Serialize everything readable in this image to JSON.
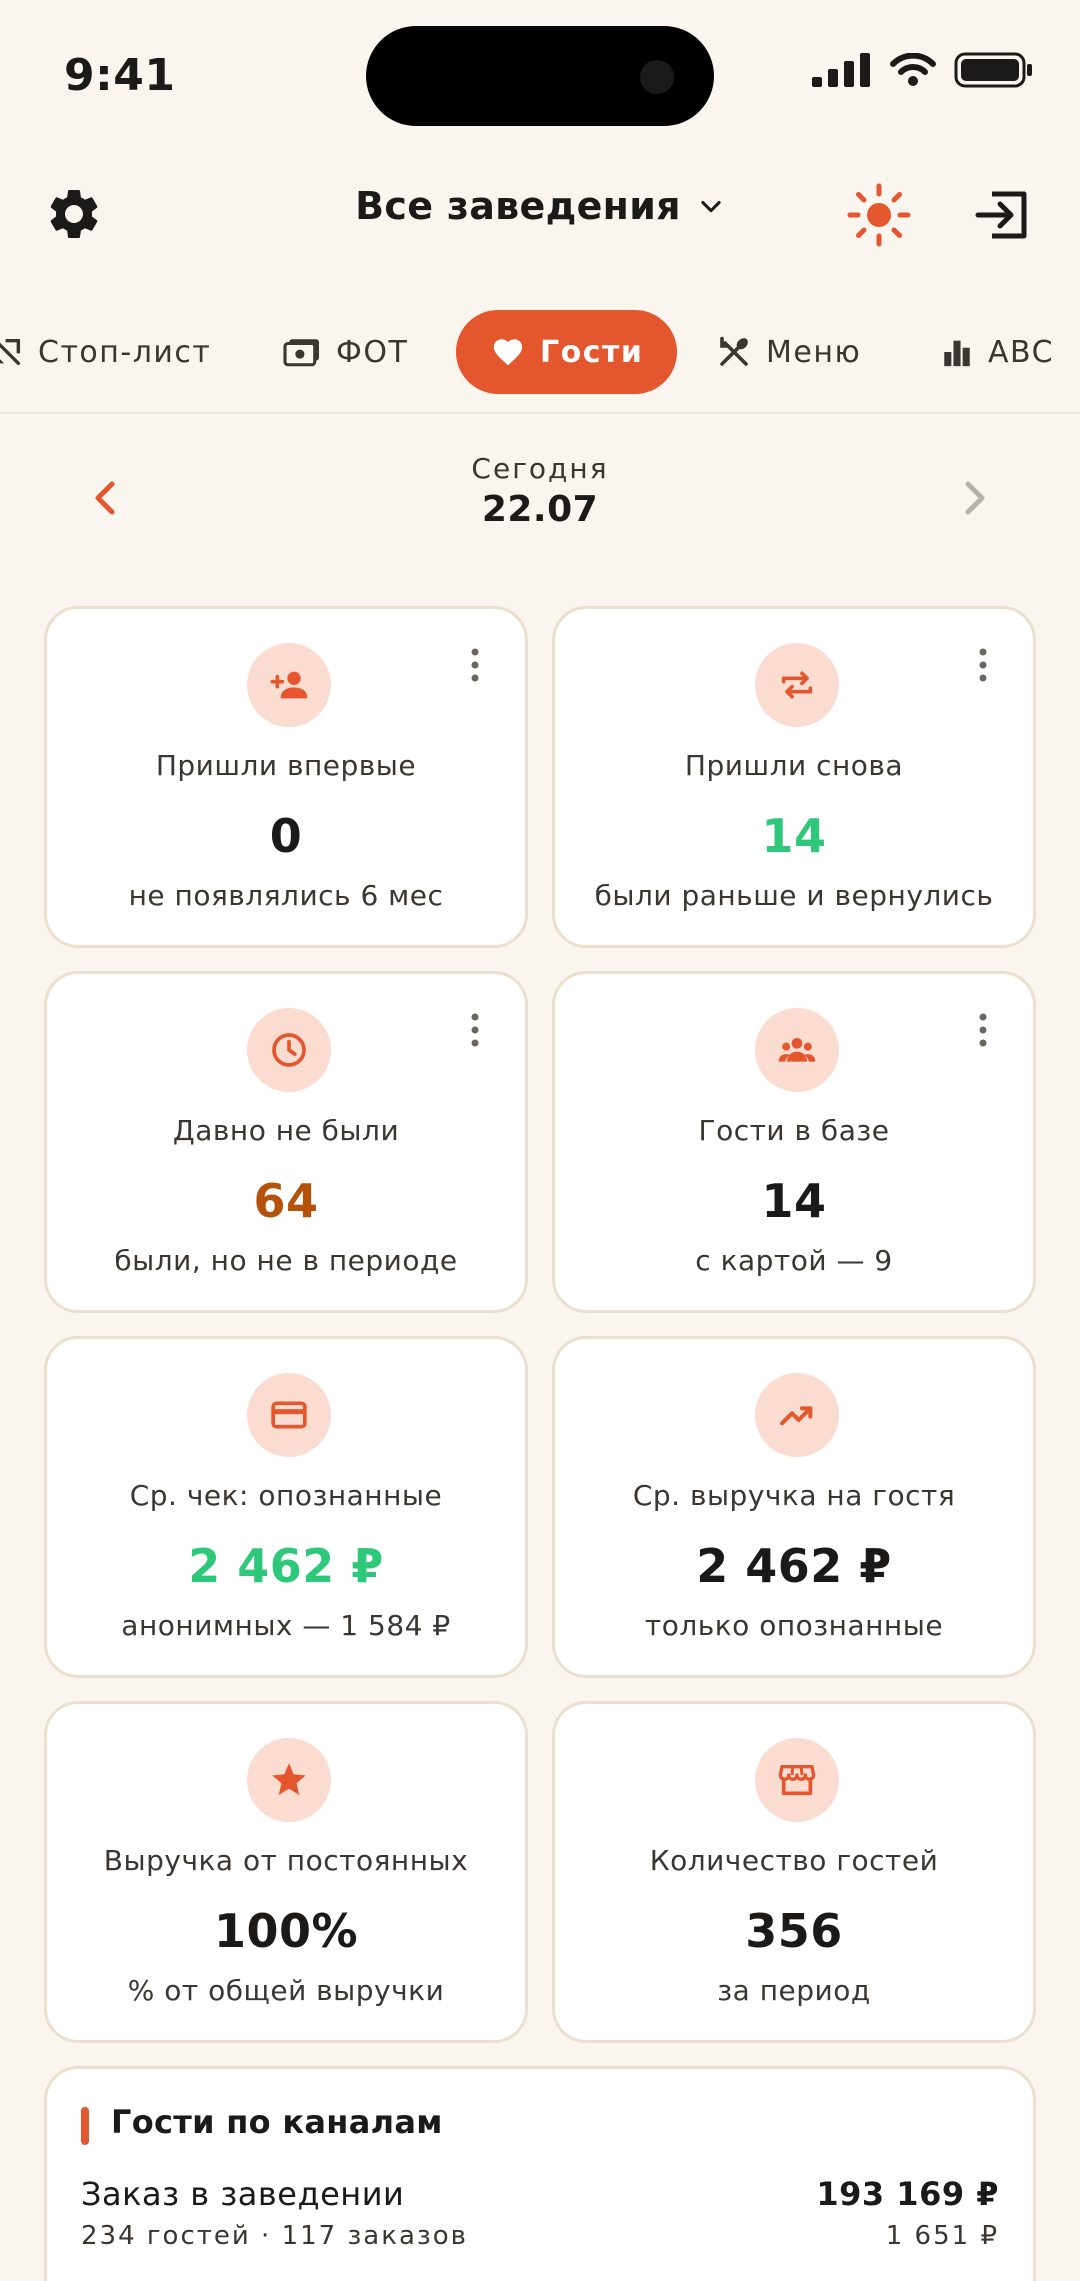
{
  "status_bar": {
    "time": "9:41"
  },
  "header": {
    "venue_title": "Все заведения"
  },
  "colors": {
    "accent": "#e4562d",
    "positive": "#2fc77a",
    "warning": "#b4520c",
    "icon_bg": "#fadcd0",
    "background": "#faf5ee"
  },
  "tabs": [
    {
      "label": "Стоп-лист",
      "icon": "stop-list-icon"
    },
    {
      "label": "ФОТ",
      "icon": "wallet-icon"
    },
    {
      "label": "Гости",
      "icon": "heart-icon",
      "active": true
    },
    {
      "label": "Меню",
      "icon": "cutlery-icon"
    },
    {
      "label": "ABC",
      "icon": "bar-chart-icon"
    }
  ],
  "date_nav": {
    "label": "Сегодня",
    "date": "22.07"
  },
  "cards": [
    {
      "title": "Пришли впервые",
      "value": "0",
      "sub": "не появлялись 6 мес",
      "icon": "person-add-icon",
      "value_color": "default"
    },
    {
      "title": "Пришли снова",
      "value": "14",
      "sub": "были раньше и вернулись",
      "icon": "repeat-icon",
      "value_color": "positive"
    },
    {
      "title": "Давно не были",
      "value": "64",
      "sub": "были, но не в периоде",
      "icon": "clock-icon",
      "value_color": "warning"
    },
    {
      "title": "Гости в базе",
      "value": "14",
      "sub": "с картой — 9",
      "icon": "group-icon",
      "value_color": "default"
    },
    {
      "title": "Ср. чек: опознанные",
      "value": "2 462 ₽",
      "sub": "анонимных — 1 584 ₽",
      "icon": "credit-card-icon",
      "value_color": "positive"
    },
    {
      "title": "Ср. выручка на гостя",
      "value": "2 462 ₽",
      "sub": "только опознанные",
      "icon": "trending-up-icon",
      "value_color": "default"
    },
    {
      "title": "Выручка от постоянных",
      "value": "100%",
      "sub": "% от общей выручки",
      "icon": "star-icon",
      "value_color": "default"
    },
    {
      "title": "Количество гостей",
      "value": "356",
      "sub": "за период",
      "icon": "store-icon",
      "value_color": "default"
    }
  ],
  "channels": {
    "title": "Гости по каналам",
    "items": [
      {
        "name": "Заказ в заведении",
        "meta": "234 гостей · 117 заказов",
        "amount": "193 169 ₽",
        "avg": "1 651 ₽"
      }
    ]
  }
}
